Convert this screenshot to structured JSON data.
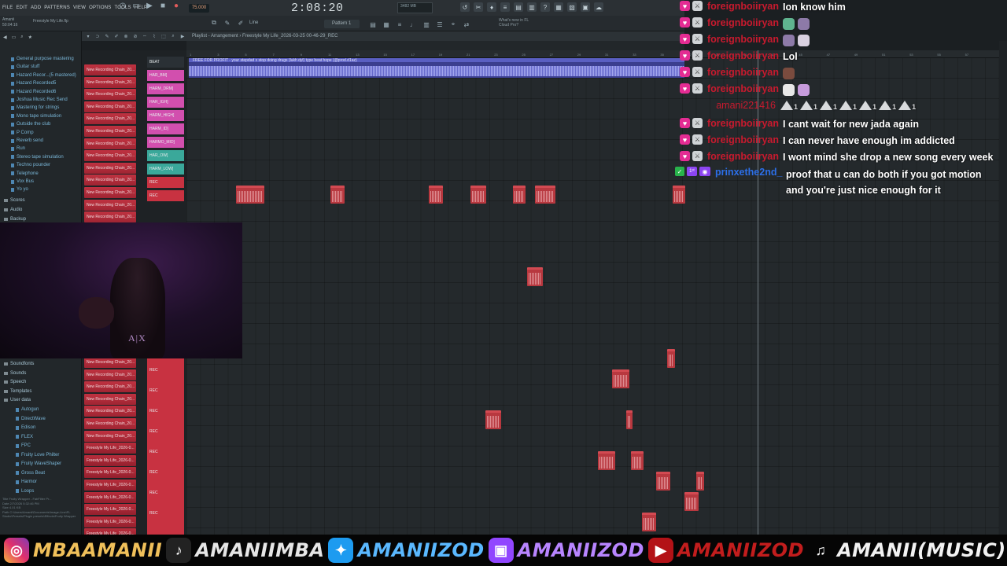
{
  "app": {
    "menu": [
      "FILE",
      "EDIT",
      "ADD",
      "PATTERNS",
      "VIEW",
      "OPTIONS",
      "TOOLS",
      "HELP"
    ],
    "tempo": "75.000",
    "time": "2:08:20",
    "pattern_label": "Pattern 1",
    "snap_label": "Line",
    "cpu_text": "3482 MB",
    "news_line1": "What's new in FL",
    "news_line2": "Cloud Pro?",
    "project_info_line1": "Amanii",
    "project_info_line2": "50:04:16",
    "project_name": "Freestyle My Life.flp"
  },
  "browser": {
    "toolbar": "Browser - All",
    "top_items": [
      "General purpose mastering",
      "Guitar stuff",
      "Hazard Recor...(5 mastered)",
      "Hazard Recorded5",
      "Hazard Recorded6",
      "Joshua Music Rec Send",
      "Mastering for strings",
      "Mono tape simulation",
      "Outside the club",
      "P Comp",
      "Reverb send",
      "Run",
      "Stereo tape simulation",
      "Techno pounder",
      "Telephone",
      "Vox Bus",
      "Yo yo"
    ],
    "mid_folders": [
      "Scores",
      "Audio",
      "Backup"
    ],
    "bottom_folders": [
      "Soundfonts",
      "Sounds",
      "Speech",
      "Templates",
      "User data"
    ],
    "bottom_items": [
      "Autogun",
      "DirectWave",
      "Edison",
      "FLEX",
      "FPC",
      "Fruity Love Philter",
      "Fruity WaveShaper",
      "Gross Beat",
      "Harmor",
      "Loops"
    ],
    "info_lines": [
      "Title   Fruity Wrapper - FabFilter Pr...",
      "Date    2/7/2026 5:32:46 PM",
      "Size    4.01 KB",
      "Path    C:\\Users\\Amanii\\Documents\\Image-Line\\FL Studio\\Presets\\Plugin presets\\Effects\\Fruity Wrapper"
    ]
  },
  "playlist": {
    "title": "Playlist - Arrangement › Freestyle My Life_2026-03-25 00-46-29_REC",
    "beat_clip_label": "FREE FOR PROFIT - your stepdad x stop doing drugs (lukh dyl) type beat hope (@prod.d1az)",
    "ruler_numbers": [
      "1",
      "3",
      "5",
      "7",
      "9",
      "11",
      "13",
      "15",
      "17",
      "19",
      "21",
      "23",
      "25",
      "27",
      "29",
      "31",
      "33",
      "35",
      "37",
      "39",
      "41",
      "43",
      "45",
      "47",
      "49",
      "51",
      "53",
      "55",
      "57"
    ],
    "track_names": [
      "New Recording Chain_20...",
      "New Recording Chain_20...",
      "New Recording Chain_20...",
      "New Recording Chain_20...",
      "New Recording Chain_20...",
      "New Recording Chain_20...",
      "New Recording Chain_20...",
      "New Recording Chain_20...",
      "New Recording Chain_20...",
      "New Recording Chain_20...",
      "New Recording Chain_20...",
      "New Recording Chain_20...",
      "New Recording Chain_20...",
      "New Recording Chain_20..."
    ],
    "track_names_bottom": [
      "New Recording Chain_20...",
      "New Recording Chain_20...",
      "New Recording Chain_20...",
      "New Recording Chain_20...",
      "New Recording Chain_20...",
      "New Recording Chain_20...",
      "New Recording Chain_20...",
      "Freestyle My Life_2026-0...",
      "Freestyle My Life_2026-0...",
      "Freestyle My Life_2026-0...",
      "Freestyle My Life_2026-0...",
      "Freestyle My Life_2026-0...",
      "Freestyle My Life_2026-0...",
      "Freestyle My Life_2026-0...",
      "Freestyle My Life_2026-0..."
    ],
    "lanes_top": [
      "BEAT",
      "HAR_BM]",
      "HARM_DRM]",
      "HAR_IGH]",
      "HARM_HIGH]",
      "HARM_ID]",
      "HARMO_MID]",
      "HAR_OW]",
      "HARM_LOW]",
      "REC",
      "REC"
    ],
    "lanes_bottom": [
      "REC",
      "REC",
      "REC",
      "REC",
      "REC",
      "REC",
      "REC",
      "REC"
    ]
  },
  "webcam": {
    "shirt_text": "A|X"
  },
  "chat": [
    {
      "user": "foreignboiiryan",
      "text": "Ion know him",
      "badges": "heart-mod"
    },
    {
      "user": "foreignboiiryan",
      "text": "",
      "badges": "heart-mod",
      "emotes": 2
    },
    {
      "user": "foreignboiiryan",
      "text": "",
      "badges": "heart-mod",
      "emotes": 2
    },
    {
      "user": "foreignboiiryan",
      "text": "Lol",
      "badges": "heart-mod"
    },
    {
      "user": "foreignboiiryan",
      "text": "",
      "badges": "heart-mod",
      "emotes": 1
    },
    {
      "user": "foreignboiiryan",
      "text": "",
      "badges": "heart-mod",
      "emotes": 2
    },
    {
      "user": "amani221416",
      "text": "1 1 1 1 1 1 1",
      "badges": "none"
    },
    {
      "user": "foreignboiiryan",
      "text": "I cant wait for new jada again",
      "badges": "heart-mod"
    },
    {
      "user": "foreignboiiryan",
      "text": "I can never have enough im addicted",
      "badges": "heart-mod"
    },
    {
      "user": "foreignboiiryan",
      "text": "I wont mind she drop a new song every week",
      "badges": "heart-mod"
    },
    {
      "user": "prinxethe2nd_",
      "text": "proof that u can do both if you got motion and you're just nice enough for it",
      "badges": "vip-prime"
    }
  ],
  "banner": [
    {
      "icon": "instagram-icon",
      "text": "MBAAMANII",
      "color": "#f0c05a"
    },
    {
      "icon": "tiktok-icon",
      "text": "AMANIIMBA",
      "color": "#e6e6e6"
    },
    {
      "icon": "twitter-icon",
      "text": "AMANIIZOD",
      "color": "#5ab8ff"
    },
    {
      "icon": "twitch-icon",
      "text": "AMANIIZOD",
      "color": "#b885ff"
    },
    {
      "icon": "youtube-icon",
      "text": "AMANIIZOD",
      "color": "#c21d1d"
    },
    {
      "icon": "music-note-icon",
      "text": "AMANII(MUSIC)",
      "color": "#f2f2f2"
    }
  ],
  "colors": {
    "clip_red": "#b8383f",
    "beat_clip_blue": "#3b3e8f",
    "chat_username_red": "#c81a2e",
    "chat_username_blue": "#2c6fe8",
    "badge_pink": "#e42c93"
  }
}
